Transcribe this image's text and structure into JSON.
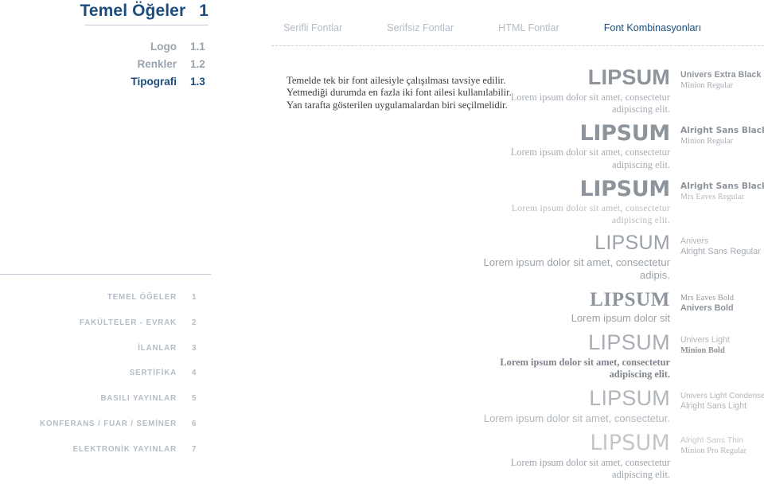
{
  "header": {
    "title": "Temel Öğeler",
    "title_number": "1"
  },
  "subnav": {
    "items": [
      {
        "label": "Logo",
        "number": "1.1",
        "active": false
      },
      {
        "label": "Renkler",
        "number": "1.2",
        "active": false
      },
      {
        "label": "Tipografi",
        "number": "1.3",
        "active": true
      }
    ]
  },
  "sectionnav": {
    "items": [
      {
        "label": "TEMEL ÖĞELER",
        "number": "1"
      },
      {
        "label": "FAKÜLTELER - EVRAK",
        "number": "2"
      },
      {
        "label": "İLANLAR",
        "number": "3"
      },
      {
        "label": "SERTİFİKA",
        "number": "4"
      },
      {
        "label": "BASILI YAYINLAR",
        "number": "5"
      },
      {
        "label": "KONFERANS / FUAR / SEMİNER",
        "number": "6"
      },
      {
        "label": "ELEKTRONİK YAYINLAR",
        "number": "7"
      }
    ]
  },
  "tabs": [
    {
      "label": "Serifli Fontlar",
      "active": false
    },
    {
      "label": "Serifsiz Fontlar",
      "active": false
    },
    {
      "label": "HTML Fontlar",
      "active": false
    },
    {
      "label": "Font Kombinasyonları",
      "active": true
    }
  ],
  "intro": {
    "text": "Temelde tek bir font ailesiyle çalışılması tavsiye edilir. Yetmediği durumda en fazla iki font ailesi kullanılabilir. Yan tarafta gösterilen uygulamalardan biri seçilmelidir."
  },
  "specimens": [
    {
      "word": "LIPSUM",
      "lorem": "Lorem ipsum dolor sit amet, consectetur adipiscing elit.",
      "font_display": "Univers Extra Black",
      "font_body": "Minion Regular"
    },
    {
      "word": "LIPSUM",
      "lorem": "Lorem ipsum dolor sit amet, consectetur adipiscing elit.",
      "font_display": "Alright Sans Black",
      "font_body": "Minion Regular"
    },
    {
      "word": "LIPSUM",
      "lorem": "Lorem ipsum dolor sit amet, consectetur adipiscing elit.",
      "font_display": "Alright Sans Black",
      "font_body": "Mrs Eaves Regular"
    },
    {
      "word": "LIPSUM",
      "lorem": "Lorem ipsum dolor sit amet, consectetur adipis.",
      "font_display": "Anivers",
      "font_body": "Alright Sans Regular"
    },
    {
      "word": "LIPSUM",
      "lorem": "Lorem ipsum dolor sit",
      "font_display": "Mrs Eaves Bold",
      "font_body": "Anivers Bold"
    },
    {
      "word": "LIPSUM",
      "lorem": "Lorem ipsum dolor sit amet, consectetur adipiscing elit.",
      "font_display": "Univers Light",
      "font_body": "Minion Bold"
    },
    {
      "word": "LIPSUM",
      "lorem": "Lorem ipsum dolor sit amet, consectetur.",
      "font_display": "Univers Light Condensed",
      "font_body": "Alright Sans Light"
    },
    {
      "word": "LIPSUM",
      "lorem": "Lorem ipsum dolor sit amet, consectetur adipiscing elit.",
      "font_display": "Alright Sans Thin",
      "font_body": "Minion Pro Regular"
    }
  ],
  "colors": {
    "accent_navy": "#1b4d7e",
    "muted_grey": "#9aa3ad",
    "rule_grey": "#c3ccd6"
  }
}
